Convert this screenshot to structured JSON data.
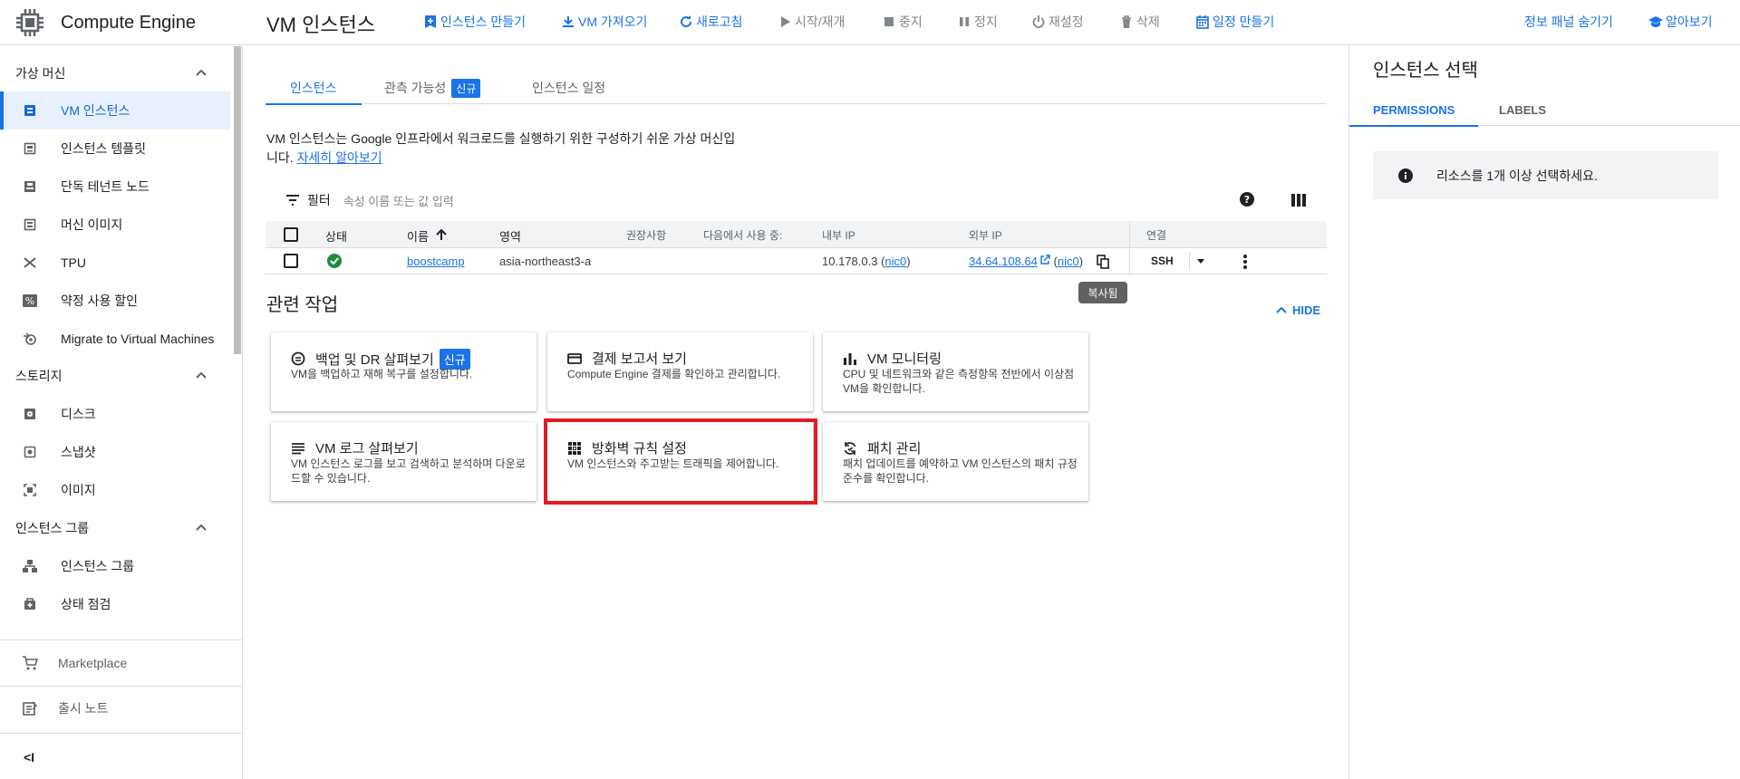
{
  "app": {
    "title": "Compute Engine"
  },
  "header": {
    "page_title": "VM 인스턴스",
    "actions": [
      {
        "label": "인스턴스 만들기",
        "icon": "add-box-icon",
        "enabled": true
      },
      {
        "label": "VM 가져오기",
        "icon": "download-icon",
        "enabled": true
      },
      {
        "label": "새로고침",
        "icon": "refresh-icon",
        "enabled": true
      },
      {
        "label": "시작/재개",
        "icon": "play-icon",
        "enabled": false
      },
      {
        "label": "중지",
        "icon": "stop-icon",
        "enabled": false
      },
      {
        "label": "정지",
        "icon": "pause-icon",
        "enabled": false
      },
      {
        "label": "재설정",
        "icon": "power-icon",
        "enabled": false
      },
      {
        "label": "삭제",
        "icon": "trash-icon",
        "enabled": false
      },
      {
        "label": "일정 만들기",
        "icon": "calendar-icon",
        "enabled": true
      }
    ],
    "hide_info_panel": "정보 패널 숨기기",
    "learn": "알아보기"
  },
  "sidebar": {
    "sections": [
      {
        "label": "가상 머신",
        "items": [
          {
            "label": "VM 인스턴스",
            "icon": "vm-icon",
            "active": true
          },
          {
            "label": "인스턴스 템플릿",
            "icon": "template-icon"
          },
          {
            "label": "단독 테넌트 노드",
            "icon": "node-icon"
          },
          {
            "label": "머신 이미지",
            "icon": "machine-image-icon"
          },
          {
            "label": "TPU",
            "icon": "tpu-icon"
          },
          {
            "label": "약정 사용 할인",
            "icon": "percent-icon"
          },
          {
            "label": "Migrate to Virtual Machines",
            "icon": "migrate-icon"
          }
        ]
      },
      {
        "label": "스토리지",
        "items": [
          {
            "label": "디스크",
            "icon": "disk-icon"
          },
          {
            "label": "스냅샷",
            "icon": "snapshot-icon"
          },
          {
            "label": "이미지",
            "icon": "image-icon"
          }
        ]
      },
      {
        "label": "인스턴스 그룹",
        "items": [
          {
            "label": "인스턴스 그룹",
            "icon": "group-icon"
          },
          {
            "label": "상태 점검",
            "icon": "health-icon"
          }
        ]
      }
    ],
    "footer": [
      {
        "label": "Marketplace",
        "icon": "cart-icon"
      },
      {
        "label": "출시 노트",
        "icon": "notes-icon"
      }
    ],
    "collapse": "<I"
  },
  "main": {
    "tabs": [
      {
        "label": "인스턴스",
        "active": true
      },
      {
        "label": "관측 가능성",
        "badge": "신규"
      },
      {
        "label": "인스턴스 일정"
      }
    ],
    "description": "VM 인스턴스는 Google 인프라에서 워크로드를 실행하기 위한 구성하기 쉬운 가상 머신입니다.",
    "description_line1": "VM 인스턴스는 Google 인프라에서 워크로드를 실행하기 위한 구성하기 쉬운 가상 머신입",
    "description_line2": "니다.",
    "learn_more": "자세히 알아보기",
    "filter": {
      "label": "필터",
      "placeholder": "속성 이름 또는 값 입력"
    },
    "table": {
      "headers": {
        "status": "상태",
        "name": "이름",
        "zone": "영역",
        "recommendation": "권장사항",
        "in_use_by": "다음에서 사용 중:",
        "internal_ip": "내부 IP",
        "external_ip": "외부 IP",
        "connect": "연결"
      },
      "rows": [
        {
          "status": "running",
          "name": "boostcamp",
          "zone": "asia-northeast3-a",
          "internal_ip": "10.178.0.3",
          "internal_nic": "nic0",
          "external_ip": "34.64.108.64",
          "external_nic": "nic0",
          "connect": "SSH"
        }
      ]
    },
    "tooltip": "복사됨",
    "related": {
      "title": "관련 작업",
      "hide": "HIDE",
      "cards": [
        {
          "title": "백업 및 DR 살펴보기",
          "badge": "신규",
          "desc": "VM을 백업하고 재해 복구를 설정합니다.",
          "icon": "backup-icon"
        },
        {
          "title": "결제 보고서 보기",
          "desc": "Compute Engine 결제를 확인하고 관리합니다.",
          "icon": "billing-icon"
        },
        {
          "title": "VM 모니터링",
          "desc": "CPU 및 네트워크와 같은 측정항목 전반에서 이상점 VM을 확인합니다.",
          "icon": "monitoring-icon"
        },
        {
          "title": "VM 로그 살펴보기",
          "desc": "VM 인스턴스 로그를 보고 검색하고 분석하며 다운로드할 수 있습니다.",
          "icon": "logs-icon"
        },
        {
          "title": "방화벽 규칙 설정",
          "desc": "VM 인스턴스와 주고받는 트래픽을 제어합니다.",
          "icon": "firewall-icon"
        },
        {
          "title": "패치 관리",
          "desc": "패치 업데이트를 예약하고 VM 인스턴스의 패치 규정 준수를 확인합니다.",
          "icon": "patch-icon"
        }
      ]
    }
  },
  "info_panel": {
    "title": "인스턴스 선택",
    "tabs": [
      {
        "label": "PERMISSIONS",
        "active": true
      },
      {
        "label": "LABELS"
      }
    ],
    "message": "리소스를 1개 이상 선택하세요."
  },
  "colors": {
    "accent": "#1a73e8",
    "highlight": "#e11b22",
    "success": "#1e8e3e"
  }
}
